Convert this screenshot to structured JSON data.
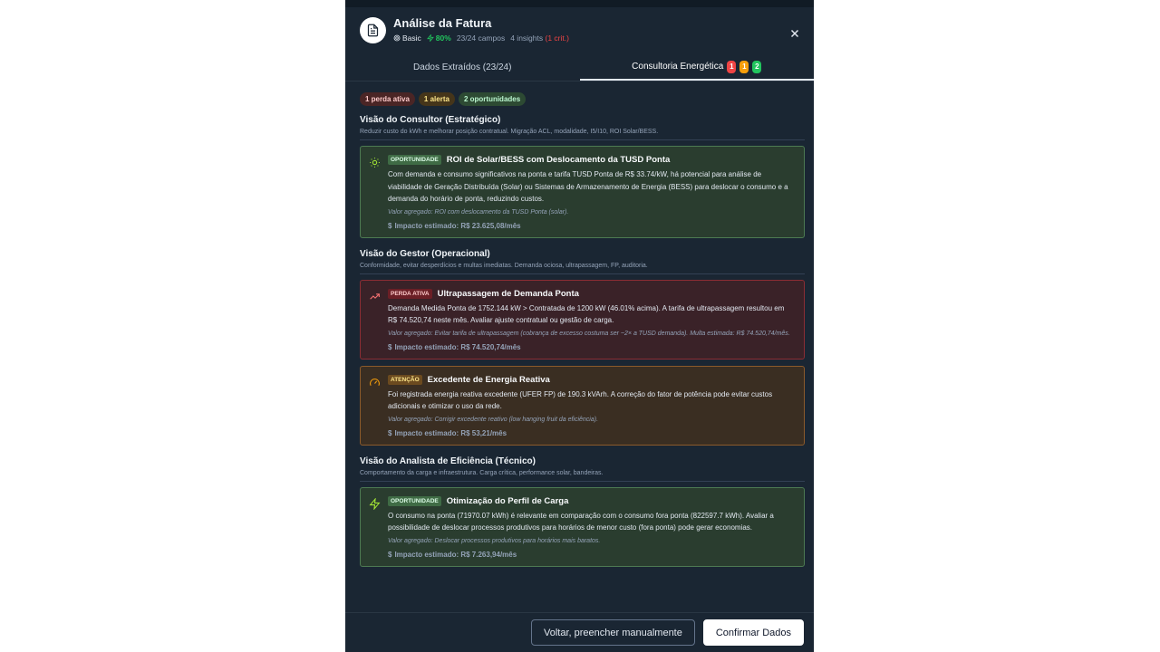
{
  "header": {
    "title": "Análise da Fatura",
    "plan": "Basic",
    "confidence": "80%",
    "fields": "23/24 campos",
    "insights": "4 insights",
    "critical": "(1 crit.)"
  },
  "tabs": [
    {
      "label": "Dados Extraídos (23/24)"
    },
    {
      "label": "Consultoria Energética",
      "counts": [
        "1",
        "1",
        "2"
      ]
    }
  ],
  "pills": {
    "loss": "1 perda ativa",
    "alert": "1 alerta",
    "opportunities": "2 oportunidades"
  },
  "sections": [
    {
      "title": "Visão do Consultor (Estratégico)",
      "subtitle": "Reduzir custo do kWh e melhorar posição contratual. Migração ACL, modalidade, I5/I10, ROI Solar/BESS.",
      "cards": [
        {
          "badge": "OPORTUNIDADE",
          "title": "ROI de Solar/BESS com Deslocamento da TUSD Ponta",
          "description": "Com demanda e consumo significativos na ponta e tarifa TUSD Ponta de R$ 33.74/kW, há potencial para análise de viabilidade de Geração Distribuída (Solar) ou Sistemas de Armazenamento de Energia (BESS) para deslocar o consumo e a demanda do horário de ponta, reduzindo custos.",
          "value": "Valor agregado: ROI com deslocamento da TUSD Ponta (solar).",
          "impact": "Impacto estimado: R$ 23.625,08/mês"
        }
      ]
    },
    {
      "title": "Visão do Gestor (Operacional)",
      "subtitle": "Conformidade, evitar desperdícios e multas imediatas. Demanda ociosa, ultrapassagem, FP, auditoria.",
      "cards": [
        {
          "badge": "PERDA ATIVA",
          "title": "Ultrapassagem de Demanda Ponta",
          "description": "Demanda Medida Ponta de 1752.144 kW > Contratada de 1200 kW (46.01% acima). A tarifa de ultrapassagem resultou em R$ 74.520,74 neste mês. Avaliar ajuste contratual ou gestão de carga.",
          "value": "Valor agregado: Evitar tarifa de ultrapassagem (cobrança de excesso costuma ser ~2× a TUSD demanda). Multa estimada: R$ 74.520,74/mês.",
          "impact": "Impacto estimado: R$ 74.520,74/mês"
        },
        {
          "badge": "ATENÇÃO",
          "title": "Excedente de Energia Reativa",
          "description": "Foi registrada energia reativa excedente (UFER FP) de 190.3 kVArh. A correção do fator de potência pode evitar custos adicionais e otimizar o uso da rede.",
          "value": "Valor agregado: Corrigir excedente reativo (low hanging fruit da eficiência).",
          "impact": "Impacto estimado: R$ 53,21/mês"
        }
      ]
    },
    {
      "title": "Visão do Analista de Eficiência (Técnico)",
      "subtitle": "Comportamento da carga e infraestrutura. Carga crítica, performance solar, bandeiras.",
      "cards": [
        {
          "badge": "OPORTUNIDADE",
          "title": "Otimização do Perfil de Carga",
          "description": "O consumo na ponta (71970.07 kWh) é relevante em comparação com o consumo fora ponta (822597.7 kWh). Avaliar a possibilidade de deslocar processos produtivos para horários de menor custo (fora ponta) pode gerar economias.",
          "value": "Valor agregado: Deslocar processos produtivos para horários mais baratos.",
          "impact": "Impacto estimado: R$ 7.263,94/mês"
        }
      ]
    }
  ],
  "footer": {
    "back_label": "Voltar, preencher manualmente",
    "confirm_label": "Confirmar Dados"
  },
  "colors": {
    "background": "#1a2633",
    "opportunity": "#4d7a52",
    "loss": "#8b2d34",
    "attention": "#8b5a2b"
  }
}
